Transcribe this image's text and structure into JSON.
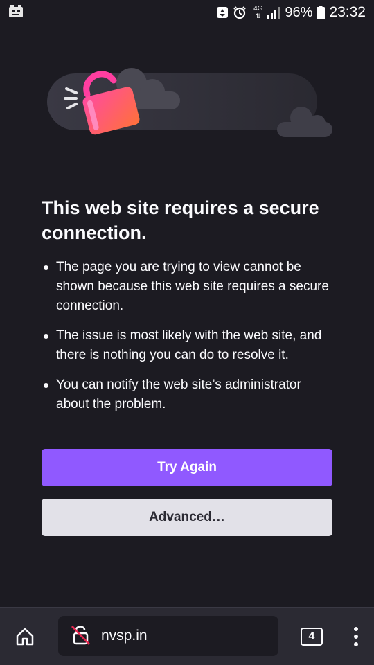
{
  "status_bar": {
    "network": "4G",
    "battery_percent": "96%",
    "time": "23:32"
  },
  "error": {
    "title": "This web site requires a secure connection.",
    "bullets": [
      "The page you are trying to view cannot be shown because this web site requires a secure connection.",
      "The issue is most likely with the web site, and there is nothing you can do to resolve it.",
      "You can notify the web site’s administrator about the problem."
    ],
    "primary_button": "Try Again",
    "secondary_button": "Advanced…"
  },
  "toolbar": {
    "url": "nvsp.in",
    "tab_count": "4"
  },
  "colors": {
    "background": "#1c1b22",
    "primary_button": "#9059ff",
    "secondary_button": "#e2e1e8",
    "toolbar": "#2b2a33"
  },
  "icons": [
    "app-notification-icon",
    "recycle-icon",
    "alarm-icon",
    "signal-icon",
    "battery-icon",
    "home-icon",
    "insecure-lock-icon",
    "tabs-icon",
    "overflow-menu-icon",
    "broken-padlock-illustration"
  ]
}
